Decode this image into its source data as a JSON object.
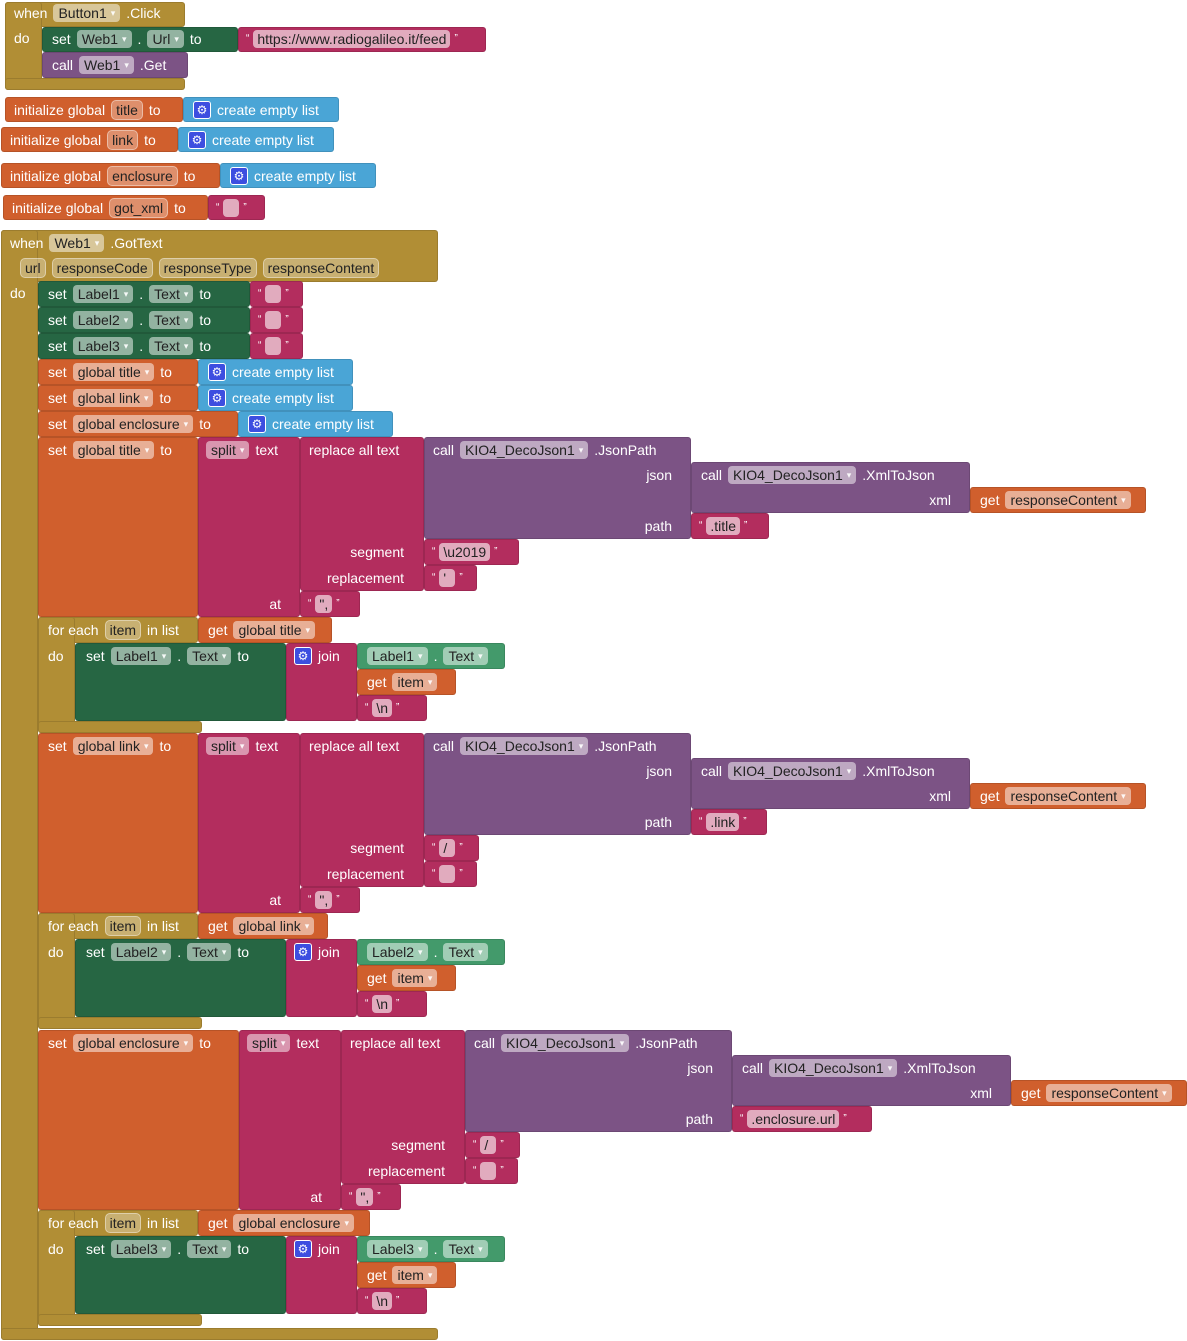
{
  "colors": {
    "event": "#b18e35",
    "setter": "#266643",
    "getter": "#439a6b",
    "variable": "#d05f2d",
    "list": "#4aa5d6",
    "text": "#b32d5e",
    "procedure": "#7c5385"
  },
  "kw": {
    "when": "when",
    "do": "do",
    "set": "set",
    "to": "to",
    "call": "call",
    "dot": ".",
    "init": "initialize global",
    "create": "create empty list",
    "split": "split",
    "text": "text",
    "replace": "replace all text",
    "json": "json",
    "xml": "xml",
    "path": "path",
    "segment": "segment",
    "replacement": "replacement",
    "at": "at",
    "foreach": "for each",
    "inlist": "in list",
    "get": "get",
    "join": "join"
  },
  "click": {
    "component": "Button1",
    "event": ".Click",
    "web": "Web1",
    "url_prop": "Url",
    "url": "https://www.radiogalileo.it/feed",
    "method": ".Get"
  },
  "globals": [
    {
      "name": "title"
    },
    {
      "name": "link"
    },
    {
      "name": "enclosure"
    },
    {
      "name": "got_xml",
      "value": ""
    }
  ],
  "gottext": {
    "component": "Web1",
    "event": ".GotText",
    "params": [
      "url",
      "responseCode",
      "responseType",
      "responseContent"
    ],
    "label_sets": [
      {
        "component": "Label1",
        "prop": "Text",
        "value": ""
      },
      {
        "component": "Label2",
        "prop": "Text",
        "value": ""
      },
      {
        "component": "Label3",
        "prop": "Text",
        "value": ""
      }
    ],
    "clear_vars": [
      "global title",
      "global link",
      "global enclosure"
    ],
    "parses": [
      {
        "var": "global title",
        "split_at": "\",",
        "decoder": "KIO4_DecoJson1",
        "json_method": ".JsonPath",
        "xml_method": ".XmlToJson",
        "xml_arg": "responseContent",
        "path": ".title",
        "segment": "\\u2019",
        "replacement": "'",
        "loop_var": "item",
        "target_label": "Label1",
        "target_prop": "Text",
        "newline": "\\n"
      },
      {
        "var": "global link",
        "split_at": "\",",
        "decoder": "KIO4_DecoJson1",
        "json_method": ".JsonPath",
        "xml_method": ".XmlToJson",
        "xml_arg": "responseContent",
        "path": ".link",
        "segment": "/",
        "replacement": "",
        "loop_var": "item",
        "target_label": "Label2",
        "target_prop": "Text",
        "newline": "\\n"
      },
      {
        "var": "global enclosure",
        "split_at": "\",",
        "decoder": "KIO4_DecoJson1",
        "json_method": ".JsonPath",
        "xml_method": ".XmlToJson",
        "xml_arg": "responseContent",
        "path": ".enclosure.url",
        "segment": "/",
        "replacement": "",
        "loop_var": "item",
        "target_label": "Label3",
        "target_prop": "Text",
        "newline": "\\n"
      }
    ]
  }
}
